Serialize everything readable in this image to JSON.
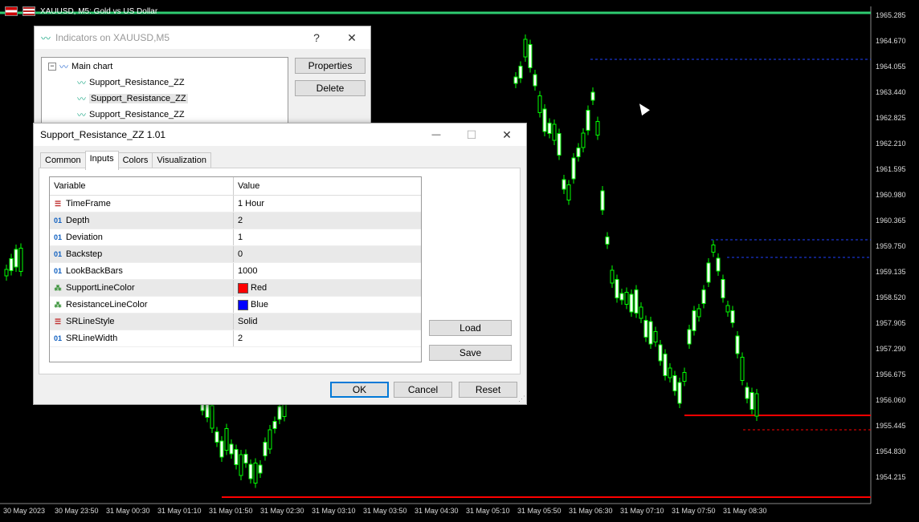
{
  "chart": {
    "title": "XAUUSD, M5:  Gold vs US Dollar",
    "price_labels": [
      "1965.285",
      "1964.670",
      "1964.055",
      "1963.440",
      "1962.825",
      "1962.210",
      "1961.595",
      "1960.980",
      "1960.365",
      "1959.750",
      "1959.135",
      "1958.520",
      "1957.905",
      "1957.290",
      "1956.675",
      "1956.060",
      "1955.445",
      "1954.830",
      "1954.215"
    ],
    "time_labels": [
      "30 May 2023",
      "30 May 23:50",
      "31 May 00:30",
      "31 May 01:10",
      "31 May 01:50",
      "31 May 02:30",
      "31 May 03:10",
      "31 May 03:50",
      "31 May 04:30",
      "31 May 05:10",
      "31 May 05:50",
      "31 May 06:30",
      "31 May 07:10",
      "31 May 07:50",
      "31 May 08:30"
    ],
    "colors": {
      "bull": "#000000",
      "bear": "#ffffff",
      "wick": "#00ff00",
      "support": "#ff0000",
      "resistance": "#0000ff",
      "top_line": "#2ecc71"
    }
  },
  "indicators_dialog": {
    "title": "Indicators on XAUUSD,M5",
    "help": "?",
    "close": "✕",
    "tree": {
      "root": "Main chart",
      "items": [
        "Support_Resistance_ZZ",
        "Support_Resistance_ZZ",
        "Support_Resistance_ZZ"
      ]
    },
    "properties_label": "Properties",
    "delete_label": "Delete"
  },
  "props_dialog": {
    "title": "Support_Resistance_ZZ 1.01",
    "minimize": "—",
    "maximize": "☐",
    "close": "✕",
    "tabs": [
      "Common",
      "Inputs",
      "Colors",
      "Visualization"
    ],
    "columns": {
      "variable": "Variable",
      "value": "Value"
    },
    "rows": [
      {
        "type": "enum",
        "type_label": "☰",
        "name": "TimeFrame",
        "value": "1 Hour"
      },
      {
        "type": "int",
        "type_label": "01",
        "name": "Depth",
        "value": "2"
      },
      {
        "type": "int",
        "type_label": "01",
        "name": "Deviation",
        "value": "1"
      },
      {
        "type": "int",
        "type_label": "01",
        "name": "Backstep",
        "value": "0"
      },
      {
        "type": "int",
        "type_label": "01",
        "name": "LookBackBars",
        "value": "1000"
      },
      {
        "type": "color",
        "type_label": "⁂",
        "name": "SupportLineColor",
        "value": "Red",
        "swatch": "#ff0000"
      },
      {
        "type": "color",
        "type_label": "⁂",
        "name": "ResistanceLineColor",
        "value": "Blue",
        "swatch": "#0000ff"
      },
      {
        "type": "enum",
        "type_label": "☰",
        "name": "SRLineStyle",
        "value": "Solid"
      },
      {
        "type": "int",
        "type_label": "01",
        "name": "SRLineWidth",
        "value": "2"
      }
    ],
    "load_label": "Load",
    "save_label": "Save",
    "ok_label": "OK",
    "cancel_label": "Cancel",
    "reset_label": "Reset"
  }
}
